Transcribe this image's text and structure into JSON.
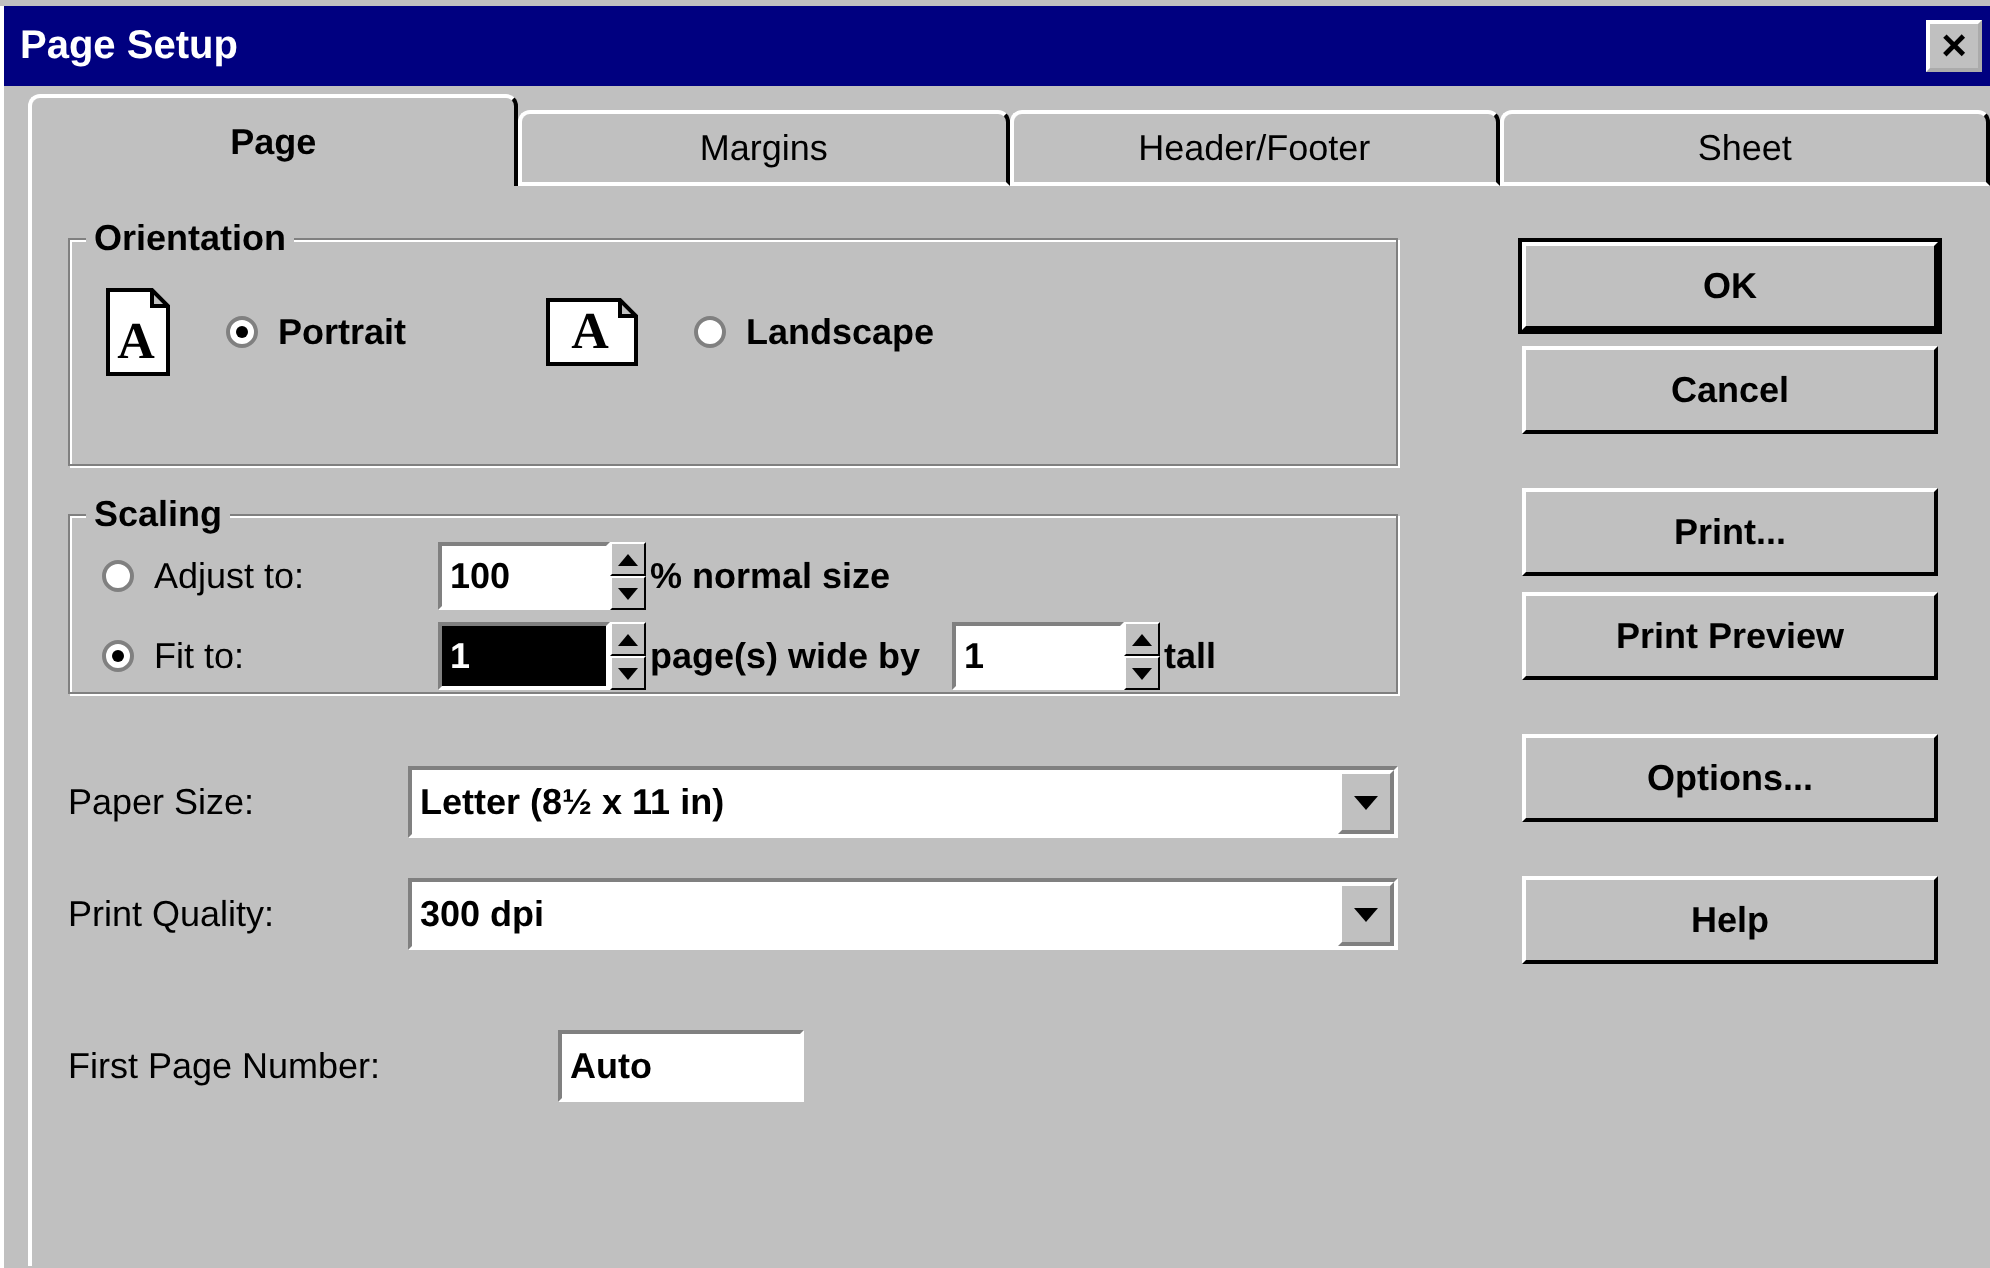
{
  "window": {
    "title": "Page Setup",
    "close": "×"
  },
  "tabs": [
    {
      "label": "Page",
      "selected": true
    },
    {
      "label": "Margins",
      "selected": false
    },
    {
      "label": "Header/Footer",
      "selected": false
    },
    {
      "label": "Sheet",
      "selected": false
    }
  ],
  "orientation": {
    "title": "Orientation",
    "options": [
      {
        "label": "Portrait",
        "selected": true,
        "kind": "portrait",
        "icon_letter": "A"
      },
      {
        "label": "Landscape",
        "selected": false,
        "kind": "landscape",
        "icon_letter": "A"
      }
    ]
  },
  "scaling": {
    "title": "Scaling",
    "rows": [
      {
        "label": "Adjust to:",
        "selected": false,
        "items": [
          {
            "kind": "spin",
            "value": "100",
            "highlighted": false
          },
          {
            "kind": "text",
            "text": "% normal size"
          }
        ]
      },
      {
        "label": "Fit to:",
        "selected": true,
        "items": [
          {
            "kind": "spin",
            "value": "1",
            "highlighted": true
          },
          {
            "kind": "text",
            "text": "page(s) wide by"
          },
          {
            "kind": "spin",
            "value": "1",
            "highlighted": false
          },
          {
            "kind": "text",
            "text": "tall"
          }
        ]
      }
    ]
  },
  "paper_size": {
    "label": "Paper Size:",
    "value": "Letter (8½ x 11 in)"
  },
  "print_quality": {
    "label": "Print Quality:",
    "value": "300 dpi"
  },
  "first_page_number": {
    "label": "First Page Number:",
    "value": "Auto"
  },
  "button_groups": [
    {
      "buttons": [
        {
          "label": "OK",
          "default": true
        },
        {
          "label": "Cancel",
          "default": false
        }
      ]
    },
    {
      "buttons": [
        {
          "label": "Print...",
          "default": false
        },
        {
          "label": "Print Preview",
          "default": false
        }
      ]
    },
    {
      "buttons": [
        {
          "label": "Options...",
          "default": false
        }
      ]
    },
    {
      "buttons": [
        {
          "label": "Help",
          "default": false
        }
      ]
    }
  ]
}
